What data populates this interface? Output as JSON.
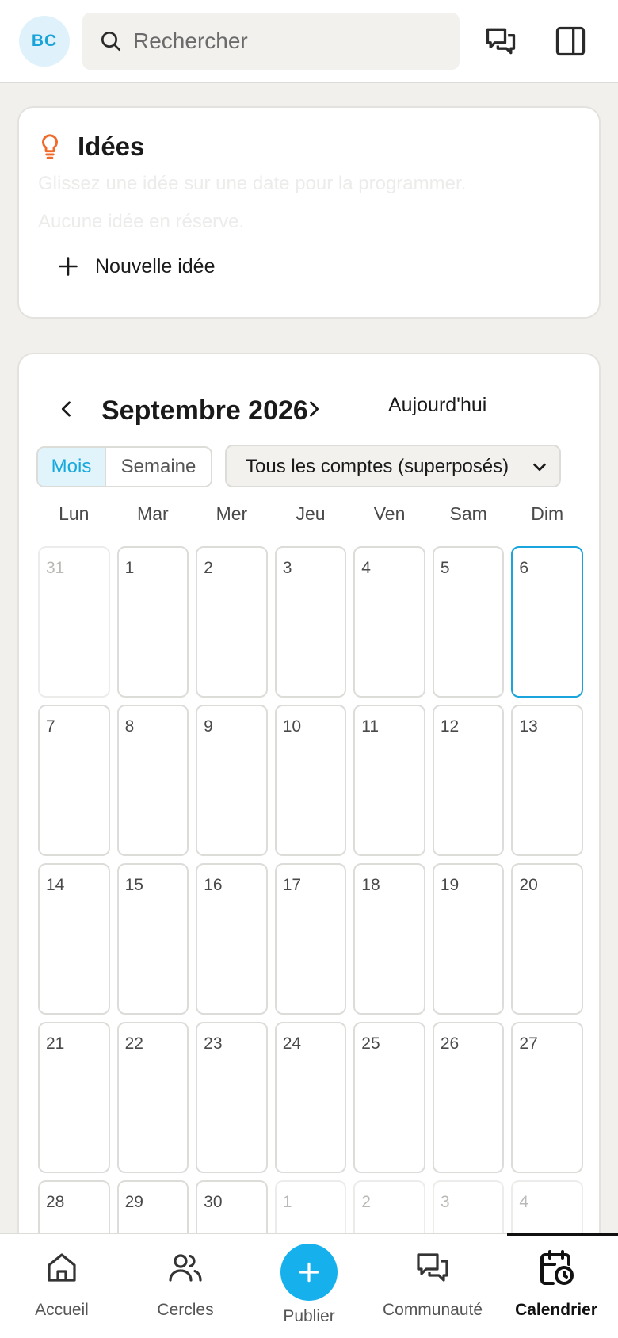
{
  "header": {
    "avatar_initials": "BC",
    "search_placeholder": "Rechercher",
    "accent_color": "#16b1ec"
  },
  "ideas": {
    "title": "Idées",
    "hint": "Glissez une idée sur une date pour la programmer.",
    "empty": "Aucune idée en réserve.",
    "new_label": "Nouvelle idée"
  },
  "calendar": {
    "month_title": "Septembre 2026",
    "today_label": "Aujourd'hui",
    "view_month": "Mois",
    "view_week": "Semaine",
    "selected_view": "Mois",
    "accounts_select": "Tous les comptes (superposés)",
    "weekdays": [
      "Lun",
      "Mar",
      "Mer",
      "Jeu",
      "Ven",
      "Sam",
      "Dim"
    ],
    "today": 6,
    "days": [
      {
        "label": "31",
        "muted": true
      },
      {
        "label": "1"
      },
      {
        "label": "2"
      },
      {
        "label": "3"
      },
      {
        "label": "4"
      },
      {
        "label": "5"
      },
      {
        "label": "6",
        "today": true
      },
      {
        "label": "7"
      },
      {
        "label": "8"
      },
      {
        "label": "9"
      },
      {
        "label": "10"
      },
      {
        "label": "11"
      },
      {
        "label": "12"
      },
      {
        "label": "13"
      },
      {
        "label": "14"
      },
      {
        "label": "15"
      },
      {
        "label": "16"
      },
      {
        "label": "17"
      },
      {
        "label": "18"
      },
      {
        "label": "19"
      },
      {
        "label": "20"
      },
      {
        "label": "21"
      },
      {
        "label": "22"
      },
      {
        "label": "23"
      },
      {
        "label": "24"
      },
      {
        "label": "25"
      },
      {
        "label": "26"
      },
      {
        "label": "27"
      },
      {
        "label": "28"
      },
      {
        "label": "29"
      },
      {
        "label": "30"
      },
      {
        "label": "1",
        "muted": true
      },
      {
        "label": "2",
        "muted": true
      },
      {
        "label": "3",
        "muted": true
      },
      {
        "label": "4",
        "muted": true
      }
    ]
  },
  "nav": {
    "home": "Accueil",
    "circles": "Cercles",
    "publish": "Publier",
    "community": "Communauté",
    "calendar": "Calendrier",
    "active": "Calendrier"
  }
}
